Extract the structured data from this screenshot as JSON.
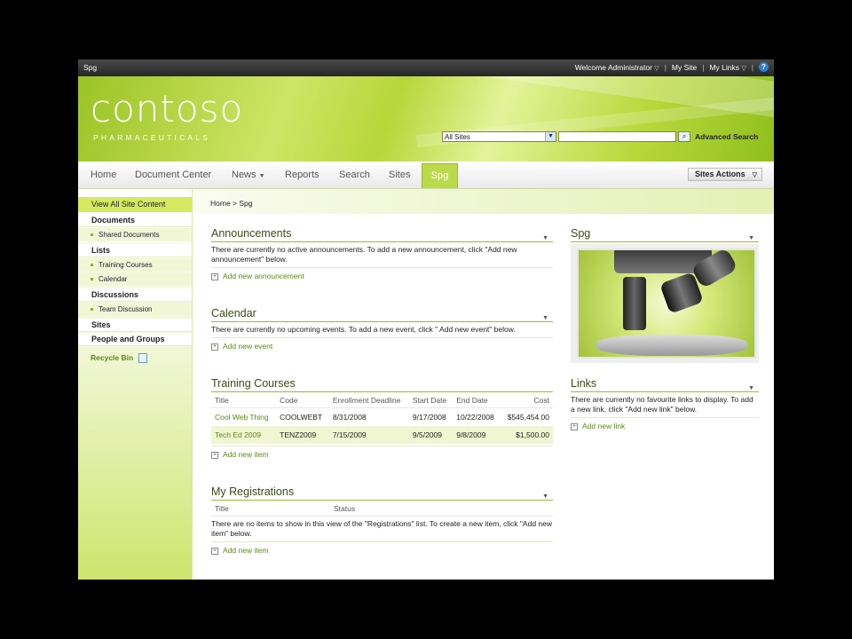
{
  "topbar": {
    "site_name": "Spg",
    "welcome": "Welcome Administrator",
    "my_site": "My Site",
    "my_links": "My Links",
    "sep": "|",
    "help_glyph": "?"
  },
  "banner": {
    "logo_text": "contoso",
    "tagline": "PHARMACEUTICALS",
    "search_scope": "All Sites",
    "search_value": "",
    "advanced_search": "Advanced Search"
  },
  "nav": {
    "tabs": [
      "Home",
      "Document Center",
      "News",
      "Reports",
      "Search",
      "Sites",
      "Spg"
    ],
    "active_tab": "Spg",
    "sites_actions": "Sites Actions"
  },
  "left_nav": {
    "view_all": "View All Site Content",
    "documents": "Documents",
    "shared_documents": "Shared Documents",
    "lists": "Lists",
    "training_courses": "Training Courses",
    "calendar": "Calendar",
    "discussions": "Discussions",
    "team_discussion": "Team Discussion",
    "sites": "Sites",
    "people_groups": "People and Groups",
    "recycle_bin": "Recycle Bin"
  },
  "breadcrumb": "Home > Spg",
  "announcements": {
    "title": "Announcements",
    "body": "There are currently no active announcements. To add a new announcement, click \"Add new announcement\" below.",
    "add": "Add new announcement"
  },
  "calendar": {
    "title": "Calendar",
    "body": "There are currently no upcoming events. To add a new event, click \" Add new event\" below.",
    "add": "Add new event"
  },
  "training_courses": {
    "title": "Training Courses",
    "columns": [
      "Title",
      "Code",
      "Enrollment Deadline",
      "Start Date",
      "End Date",
      "Cost"
    ],
    "rows": [
      [
        "Cool Web Thing",
        "COOLWEBT",
        "8/31/2008",
        "9/17/2008",
        "10/22/2008",
        "$545,454.00"
      ],
      [
        "Tech Ed 2009",
        "TENZ2009",
        "7/15/2009",
        "9/5/2009",
        "9/8/2009",
        "$1,500.00"
      ]
    ],
    "add": "Add new item"
  },
  "registrations": {
    "title": "My Registrations",
    "columns": [
      "Title",
      "Status"
    ],
    "body": "There are no items to show in this view of the \"Registrations\" list. To create a new item, click \"Add new item\" below.",
    "add": "Add new item"
  },
  "spg_part": {
    "title": "Spg"
  },
  "links": {
    "title": "Links",
    "body": "There are currently no favourite links to display. To add a new link, click \"Add new link\" below.",
    "add": "Add new link"
  },
  "colors": {
    "accent_green": "#bcd94a",
    "link_green": "#5a8a10",
    "topbar": "#2e2e2e"
  }
}
